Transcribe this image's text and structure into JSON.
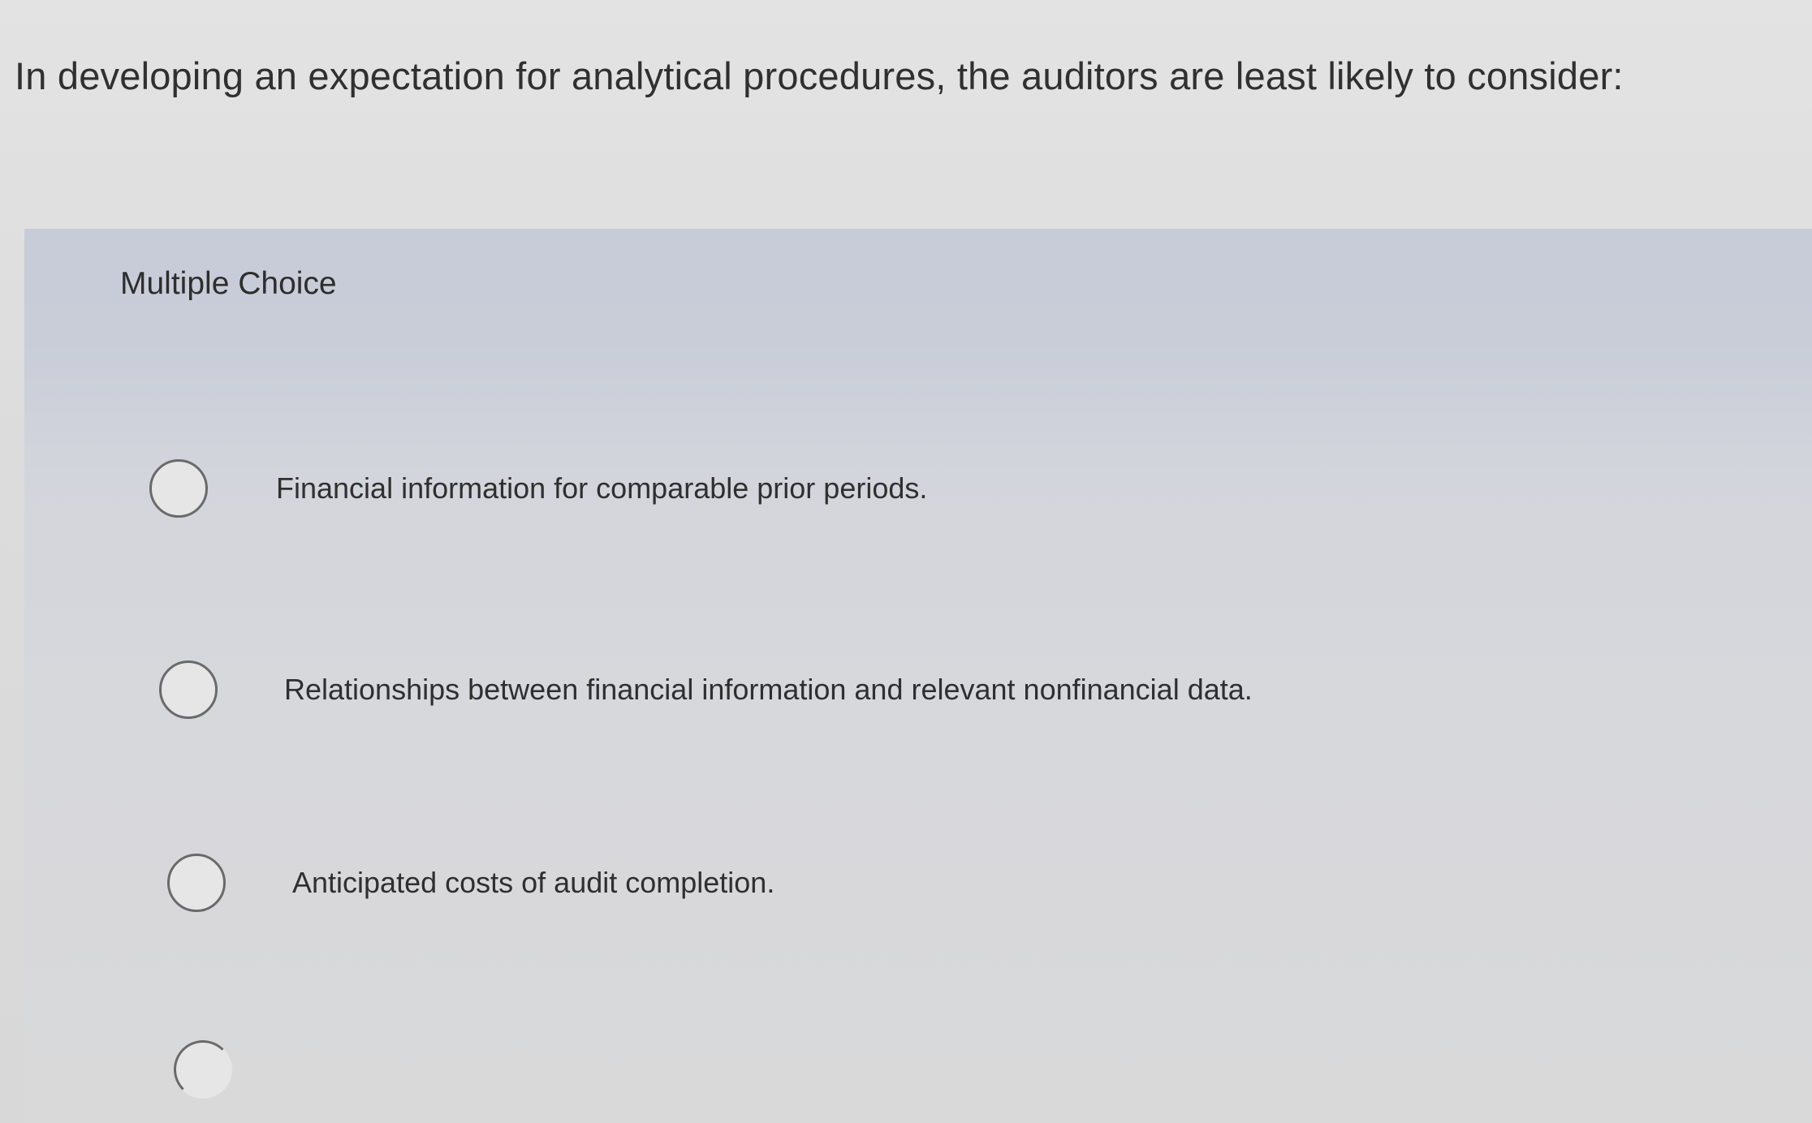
{
  "question": {
    "text": "In developing an expectation for analytical procedures, the auditors are least likely to consider:"
  },
  "multiple_choice": {
    "header": "Multiple Choice",
    "options": [
      {
        "label": "Financial information for comparable prior periods.",
        "selected": false
      },
      {
        "label": "Relationships between financial information and relevant nonfinancial data.",
        "selected": false
      },
      {
        "label": "Anticipated costs of audit completion.",
        "selected": false
      },
      {
        "label": "",
        "selected": false
      }
    ]
  },
  "colors": {
    "panel_top": "#c8ccd8",
    "page_background": "#dcdcdc",
    "text": "#2f2f2f",
    "radio_border": "#6a6a6a"
  },
  "icons": [
    "radio-button-unchecked"
  ]
}
